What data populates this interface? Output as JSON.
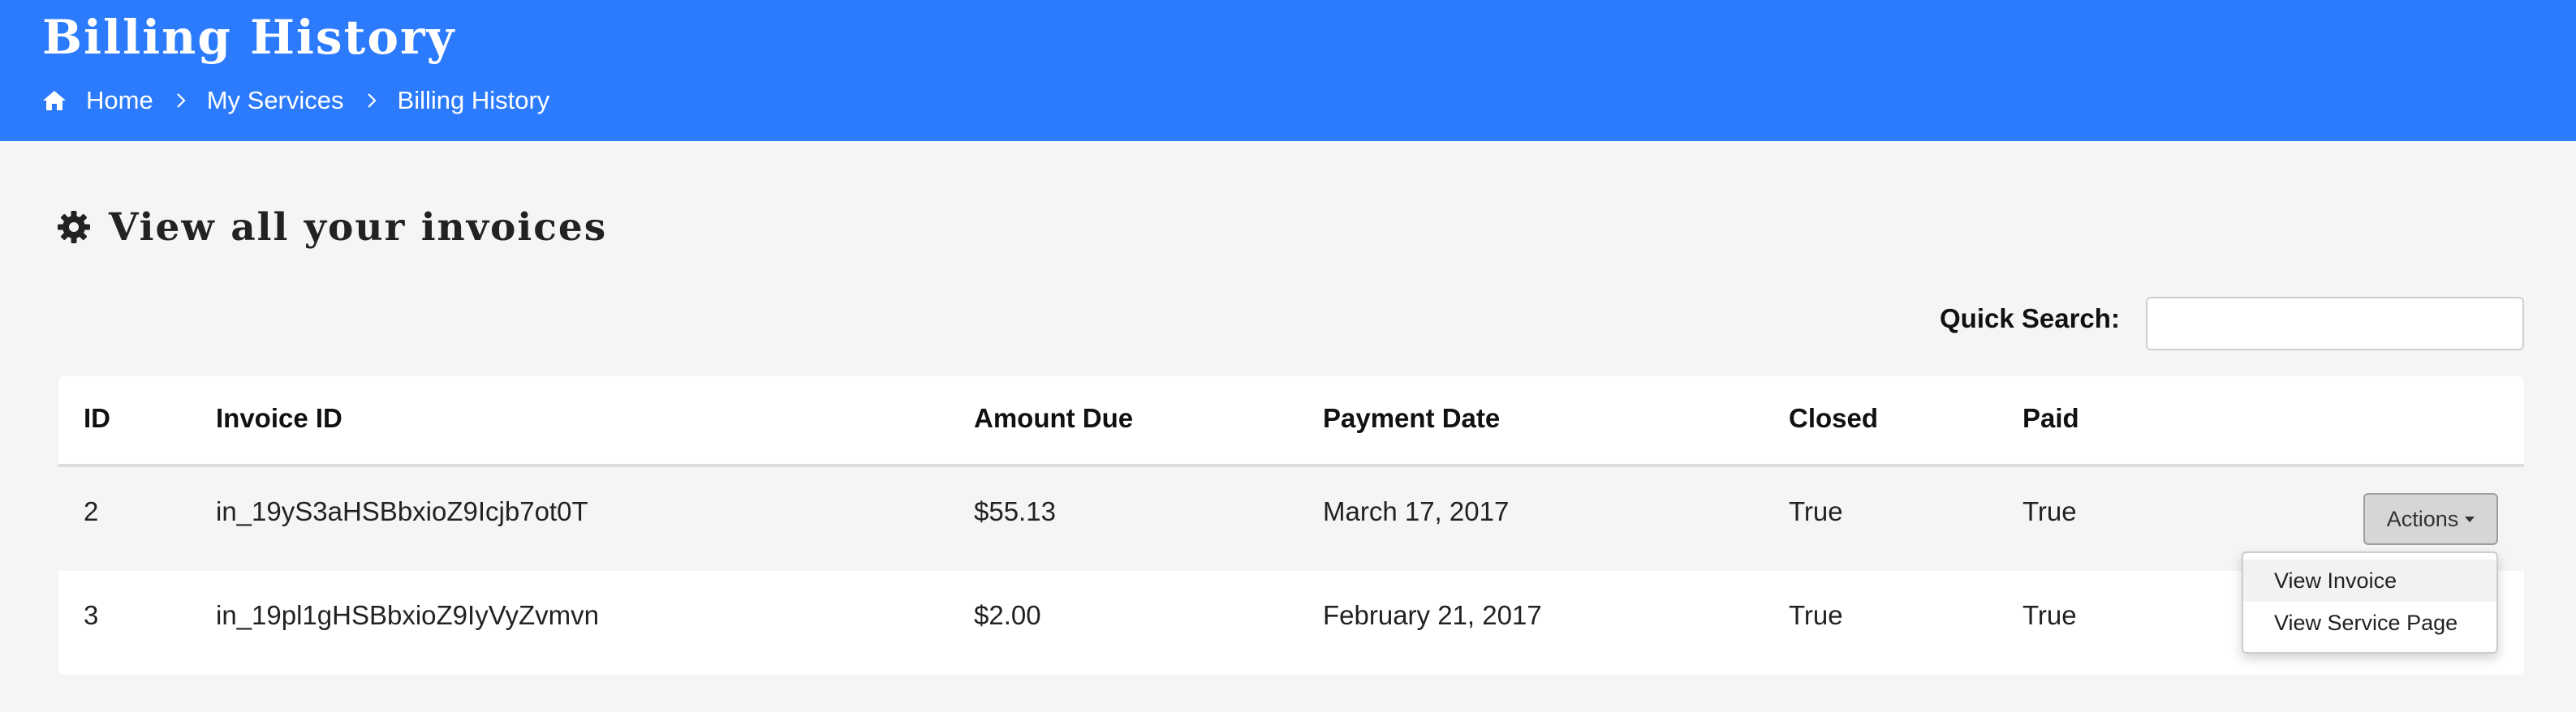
{
  "header": {
    "title": "Billing History",
    "breadcrumb": [
      "Home",
      "My Services",
      "Billing History"
    ],
    "background_color": "#2b7bfc"
  },
  "section": {
    "title": "View all your invoices",
    "icon": "gear-icon"
  },
  "search": {
    "label": "Quick Search:",
    "value": "",
    "placeholder": ""
  },
  "table": {
    "columns": [
      "ID",
      "Invoice ID",
      "Amount Due",
      "Payment Date",
      "Closed",
      "Paid"
    ],
    "rows": [
      {
        "id": "2",
        "invoice_id": "in_19yS3aHSBbxioZ9Icjb7ot0T",
        "amount_due": "$55.13",
        "payment_date": "March 17, 2017",
        "closed": "True",
        "paid": "True"
      },
      {
        "id": "3",
        "invoice_id": "in_19pl1gHSBbxioZ9IyVyZvmvn",
        "amount_due": "$2.00",
        "payment_date": "February 21, 2017",
        "closed": "True",
        "paid": "True"
      }
    ]
  },
  "actions": {
    "button_label": "Actions",
    "menu_items": [
      "View Invoice",
      "View Service Page"
    ],
    "highlighted_item": "View Invoice"
  }
}
